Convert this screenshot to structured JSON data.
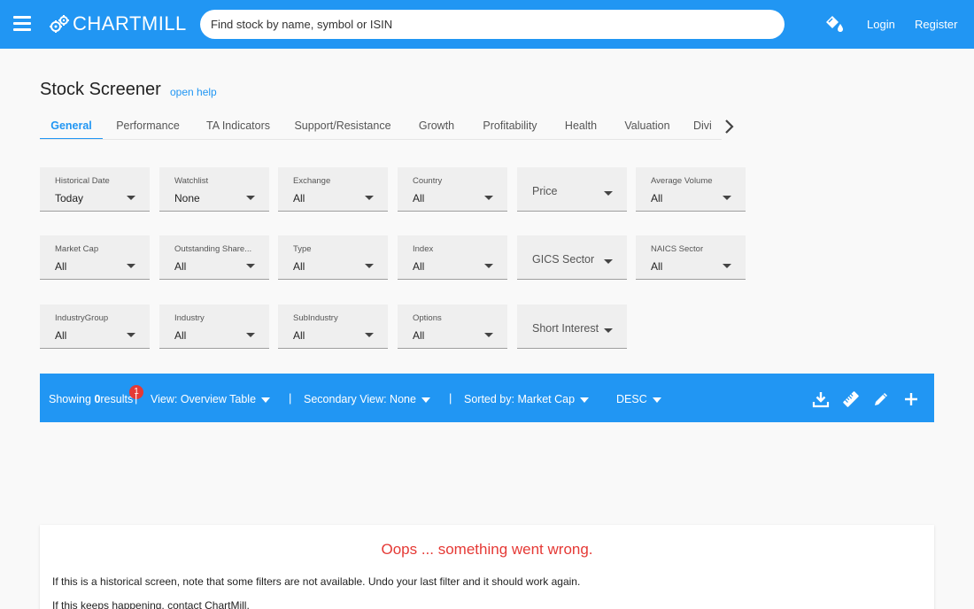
{
  "header": {
    "logo_text": "ChartMill",
    "search_placeholder": "Find stock by name, symbol or ISIN",
    "login": "Login",
    "register": "Register"
  },
  "page": {
    "title": "Stock Screener",
    "help_link": "open help"
  },
  "tabs": [
    {
      "label": "General",
      "active": true
    },
    {
      "label": "Performance"
    },
    {
      "label": "TA Indicators"
    },
    {
      "label": "Support/Resistance"
    },
    {
      "label": "Growth"
    },
    {
      "label": "Profitability"
    },
    {
      "label": "Health"
    },
    {
      "label": "Valuation"
    },
    {
      "label": "Divi"
    }
  ],
  "filters": [
    {
      "label": "Historical Date",
      "value": "Today"
    },
    {
      "label": "Watchlist",
      "value": "None"
    },
    {
      "label": "Exchange",
      "value": "All"
    },
    {
      "label": "Country",
      "value": "All"
    },
    {
      "label": "Price",
      "value": ""
    },
    {
      "label": "Average Volume",
      "value": "All"
    },
    {
      "label": "Market Cap",
      "value": "All"
    },
    {
      "label": "Outstanding Share...",
      "value": "All"
    },
    {
      "label": "Type",
      "value": "All"
    },
    {
      "label": "Index",
      "value": "All"
    },
    {
      "label": "GICS Sector",
      "value": ""
    },
    {
      "label": "NAICS Sector",
      "value": "All"
    },
    {
      "label": "IndustryGroup",
      "value": "All"
    },
    {
      "label": "Industry",
      "value": "All"
    },
    {
      "label": "SubIndustry",
      "value": "All"
    },
    {
      "label": "Options",
      "value": "All"
    },
    {
      "label": "Short Interest",
      "value": ""
    }
  ],
  "results_bar": {
    "showing_prefix": "Showing ",
    "count": "0",
    "showing_suffix": "results",
    "badge": "1",
    "view": "View: Overview Table",
    "secondary_view": "Secondary View: None",
    "sorted_by": "Sorted by: Market Cap",
    "order": "DESC",
    "separator": "|"
  },
  "error": {
    "title": "Oops ... something went wrong.",
    "line1": "If this is a historical screen, note that some filters are not available. Undo your last filter and it should work again.",
    "line2": "If this keeps happening, contact ChartMill."
  },
  "colors": {
    "primary": "#2196f3",
    "error": "#e53935",
    "background": "#f9f9f9"
  },
  "icons": [
    "menu-icon",
    "gear-logo-icon",
    "paint-bucket-icon",
    "chevron-right-icon",
    "download-icon",
    "ruler-icon",
    "pencil-icon",
    "plus-icon"
  ]
}
